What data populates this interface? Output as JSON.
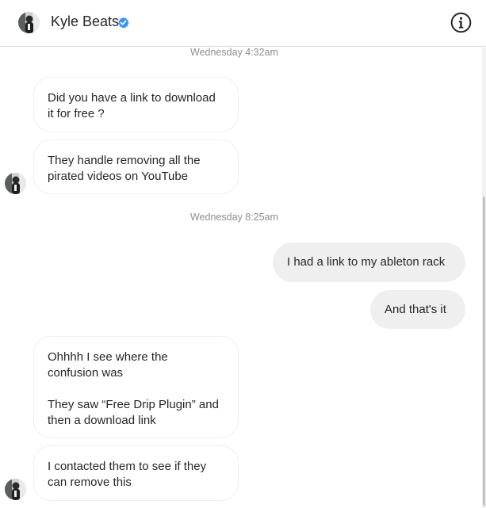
{
  "header": {
    "contact_name": "Kyle Beats",
    "avatar_icon": "profile-photo",
    "verified_icon": "verified-badge-icon",
    "verified_color": "#3897f0",
    "info_icon": "info-icon"
  },
  "thread": {
    "timestamps": [
      "Wednesday 4:32am",
      "Wednesday 8:25am"
    ],
    "messages": [
      {
        "from": "contact",
        "text": "Did you have a link to download\nit for free ?"
      },
      {
        "from": "contact",
        "text": "They handle removing all the\npirated videos on YouTube"
      },
      {
        "from": "me",
        "text": "I had a link to my ableton rack"
      },
      {
        "from": "me",
        "text": "And that's it"
      },
      {
        "from": "contact",
        "text": "Ohhhh I see where the\nconfusion was\n\nThey saw “Free Drip Plugin” and\nthen a download link"
      },
      {
        "from": "contact",
        "text": "I contacted them to see if they\ncan remove this"
      }
    ]
  },
  "colors": {
    "outgoing_bubble": "#efefef",
    "incoming_border": "#efefef",
    "timestamp_text": "#8e8e8e"
  }
}
